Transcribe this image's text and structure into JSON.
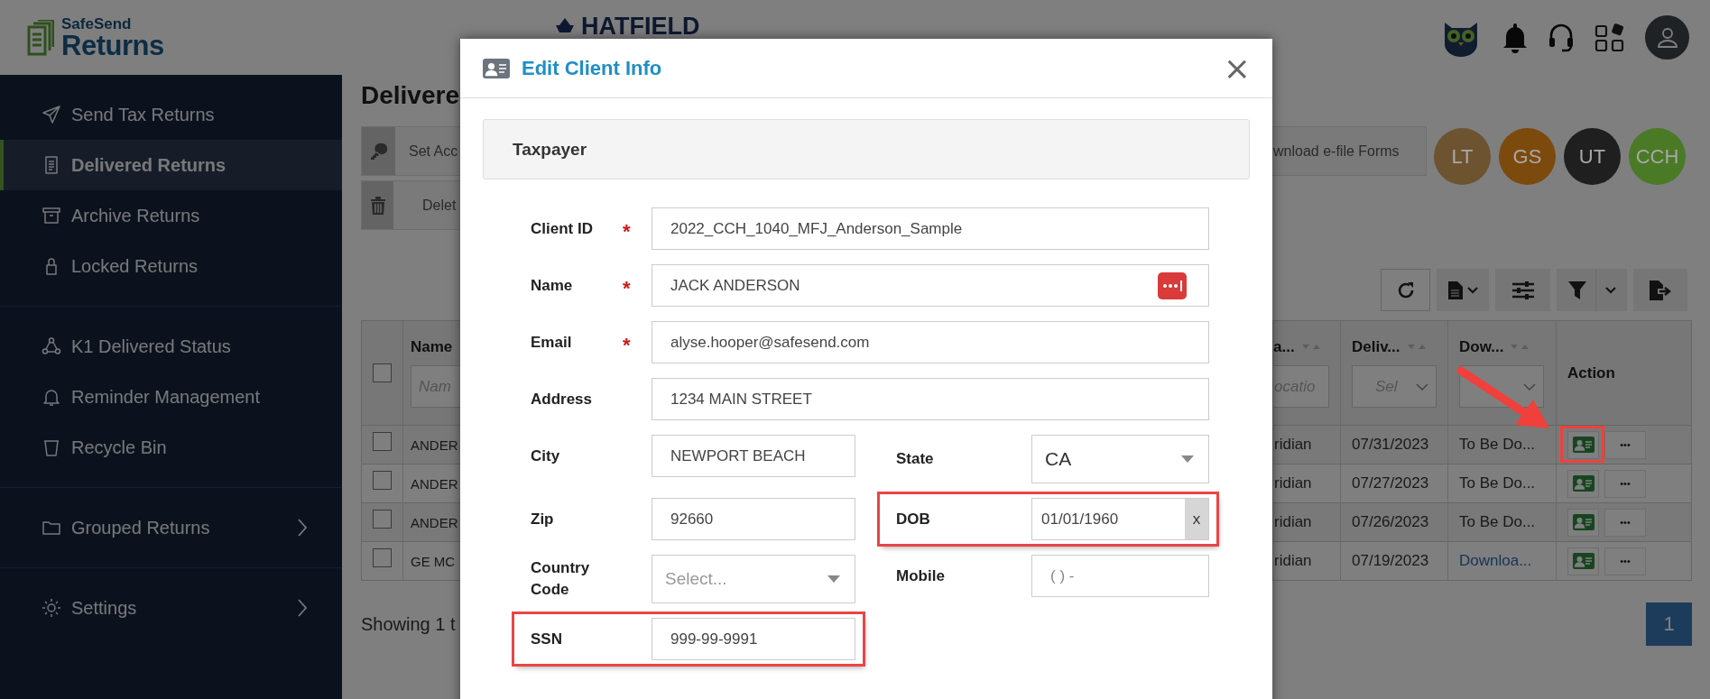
{
  "header": {
    "brand_small": "SafeSend",
    "brand": "Returns",
    "company": "HATFIELD"
  },
  "sidebar": {
    "groups": [
      {
        "items": [
          {
            "label": "Send Tax Returns",
            "selected": false
          },
          {
            "label": "Delivered Returns",
            "selected": true
          },
          {
            "label": "Archive Returns",
            "selected": false
          },
          {
            "label": "Locked Returns",
            "selected": false
          }
        ]
      },
      {
        "items": [
          {
            "label": "K1 Delivered Status",
            "selected": false
          },
          {
            "label": "Reminder Management",
            "selected": false
          },
          {
            "label": "Recycle Bin",
            "selected": false
          }
        ]
      },
      {
        "items": [
          {
            "label": "Grouped Returns",
            "selected": false,
            "has_submenu": true
          }
        ]
      },
      {
        "items": [
          {
            "label": "Settings",
            "selected": false,
            "has_submenu": true
          }
        ]
      }
    ]
  },
  "page": {
    "title": "Delivere",
    "actions": [
      {
        "label": "Set Acc"
      },
      {
        "label": "Delet"
      }
    ],
    "download_button": "wnload e-file Forms",
    "users": [
      {
        "initials": "LT",
        "color": "#6e5331"
      },
      {
        "initials": "GS",
        "color": "#7c4a0d"
      },
      {
        "initials": "UT",
        "color": "#1f1f1f"
      },
      {
        "initials": "CCH",
        "color": "#4a7a26"
      }
    ]
  },
  "table": {
    "select_all_checked": false,
    "columns": [
      {
        "label": "Name",
        "kind": "text",
        "filter_placeholder": "Nam",
        "sortable": false
      },
      {
        "label": "a...",
        "kind": "text",
        "filter_placeholder": "ocatio",
        "sortable": true
      },
      {
        "label": "Deliv...",
        "kind": "select",
        "filter_placeholder": "Sel",
        "sortable": true
      },
      {
        "label": "Dow...",
        "kind": "select",
        "sortable": true
      },
      {
        "label": "Action",
        "kind": "none",
        "sortable": false
      }
    ],
    "rows": [
      {
        "checked": false,
        "name": "ANDER",
        "col_2": "ridian",
        "delivered": "07/31/2023",
        "download": "To Be Do...",
        "download_link": false,
        "more": "•••",
        "highlighted": true
      },
      {
        "checked": false,
        "name": "ANDER",
        "col_2": "ridian",
        "delivered": "07/27/2023",
        "download": "To Be Do...",
        "download_link": false,
        "more": "•••",
        "highlighted": false
      },
      {
        "checked": false,
        "name": "ANDER",
        "col_2": "ridian",
        "delivered": "07/26/2023",
        "download": "To Be Do...",
        "download_link": false,
        "more": "•••",
        "highlighted": false
      },
      {
        "checked": false,
        "name": "GE MC",
        "col_2": "ridian",
        "delivered": "07/19/2023",
        "download": "Downloa...",
        "download_link": true,
        "more": "•••",
        "highlighted": false
      }
    ]
  },
  "footer": {
    "showing": "Showing 1 t",
    "pages": [
      {
        "label": "1",
        "selected": true
      }
    ]
  },
  "modal": {
    "title": "Edit Client Info",
    "close_label": "×",
    "section": "Taxpayer",
    "rows": [
      [
        {
          "label": "Client ID",
          "required_mark": "*",
          "kind": "text",
          "value": "2022_CCH_1040_MFJ_Anderson_Sample",
          "wide": true,
          "highlighted": false
        }
      ],
      [
        {
          "label": "Name",
          "required_mark": "*",
          "kind": "text",
          "value": "JACK ANDERSON",
          "wide": true,
          "autofill_icon": true,
          "highlighted": false
        }
      ],
      [
        {
          "label": "Email",
          "required_mark": "*",
          "kind": "text",
          "value": "alyse.hooper@safesend.com",
          "wide": true,
          "highlighted": false
        }
      ],
      [
        {
          "label": "Address",
          "kind": "text",
          "value": "1234 MAIN STREET",
          "wide": true,
          "highlighted": false
        }
      ],
      [
        {
          "label": "City",
          "kind": "text",
          "value": "NEWPORT BEACH",
          "wide": false,
          "highlighted": false
        },
        {
          "label": "State",
          "kind": "select",
          "value": "CA",
          "wide": false,
          "highlighted": false
        }
      ],
      [
        {
          "label": "Zip",
          "kind": "text",
          "value": "92660",
          "wide": false,
          "highlighted": false
        },
        {
          "label": "DOB",
          "kind": "date",
          "value": "01/01/1960",
          "clear_label": "x",
          "wide": false,
          "highlighted": true
        }
      ],
      [
        {
          "label": "Country Code",
          "kind": "select",
          "placeholder": "Select...",
          "wide": false,
          "highlighted": false
        },
        {
          "label": "Mobile",
          "kind": "text",
          "placeholder": "( ) -",
          "wide": false,
          "highlighted": false
        }
      ],
      [
        {
          "label": "SSN",
          "kind": "text",
          "value": "999-99-9991",
          "wide": false,
          "highlighted": true
        }
      ]
    ]
  }
}
